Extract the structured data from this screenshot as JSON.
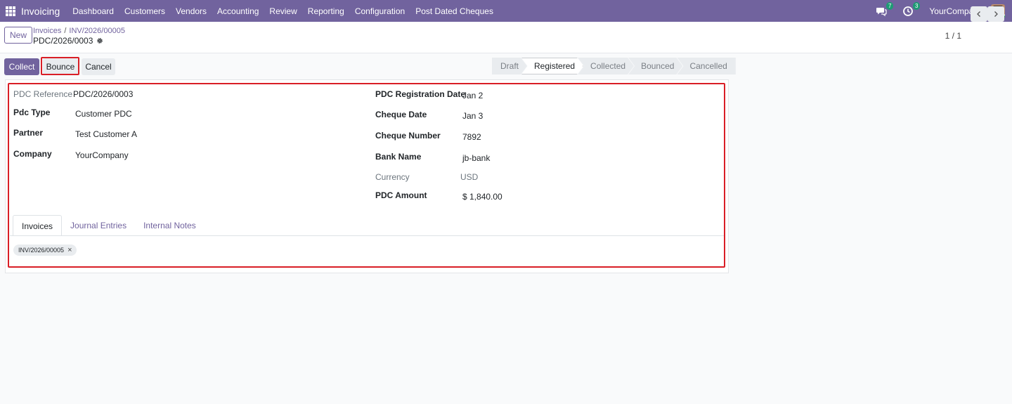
{
  "nav": {
    "app_name": "Invoicing",
    "menu": [
      "Dashboard",
      "Customers",
      "Vendors",
      "Accounting",
      "Review",
      "Reporting",
      "Configuration",
      "Post Dated Cheques"
    ],
    "messages_badge": "7",
    "activities_badge": "3",
    "company": "YourCompany"
  },
  "control": {
    "new_label": "New",
    "breadcrumb": [
      "Invoices",
      "INV/2026/00005"
    ],
    "record_title": "PDC/2026/0003",
    "pager": "1 / 1"
  },
  "actions": {
    "collect": "Collect",
    "bounce": "Bounce",
    "cancel": "Cancel"
  },
  "status": {
    "stages": [
      "Draft",
      "Registered",
      "Collected",
      "Bounced",
      "Cancelled"
    ],
    "active": "Registered"
  },
  "form": {
    "left": [
      {
        "label": "PDC Reference",
        "value": "PDC/2026/0003"
      },
      {
        "label": "Pdc Type",
        "value": "Customer PDC"
      },
      {
        "label": "Partner",
        "value": "Test Customer A"
      },
      {
        "label": "Company",
        "value": "YourCompany"
      }
    ],
    "right": [
      {
        "label": "PDC Registration Date",
        "value": "Jan 2"
      },
      {
        "label": "Cheque Date",
        "value": "Jan 3"
      },
      {
        "label": "Cheque Number",
        "value": "7892"
      },
      {
        "label": "Bank Name",
        "value": "jb-bank"
      },
      {
        "label": "Currency",
        "value": "USD"
      },
      {
        "label": "PDC Amount",
        "value": "$ 1,840.00"
      }
    ]
  },
  "tabs": [
    "Invoices",
    "Journal Entries",
    "Internal Notes"
  ],
  "invoice_tags": [
    "INV/2026/00005"
  ],
  "colors": {
    "brand": "#71639e",
    "highlight": "#d91e26",
    "badge": "#1e9b74"
  }
}
